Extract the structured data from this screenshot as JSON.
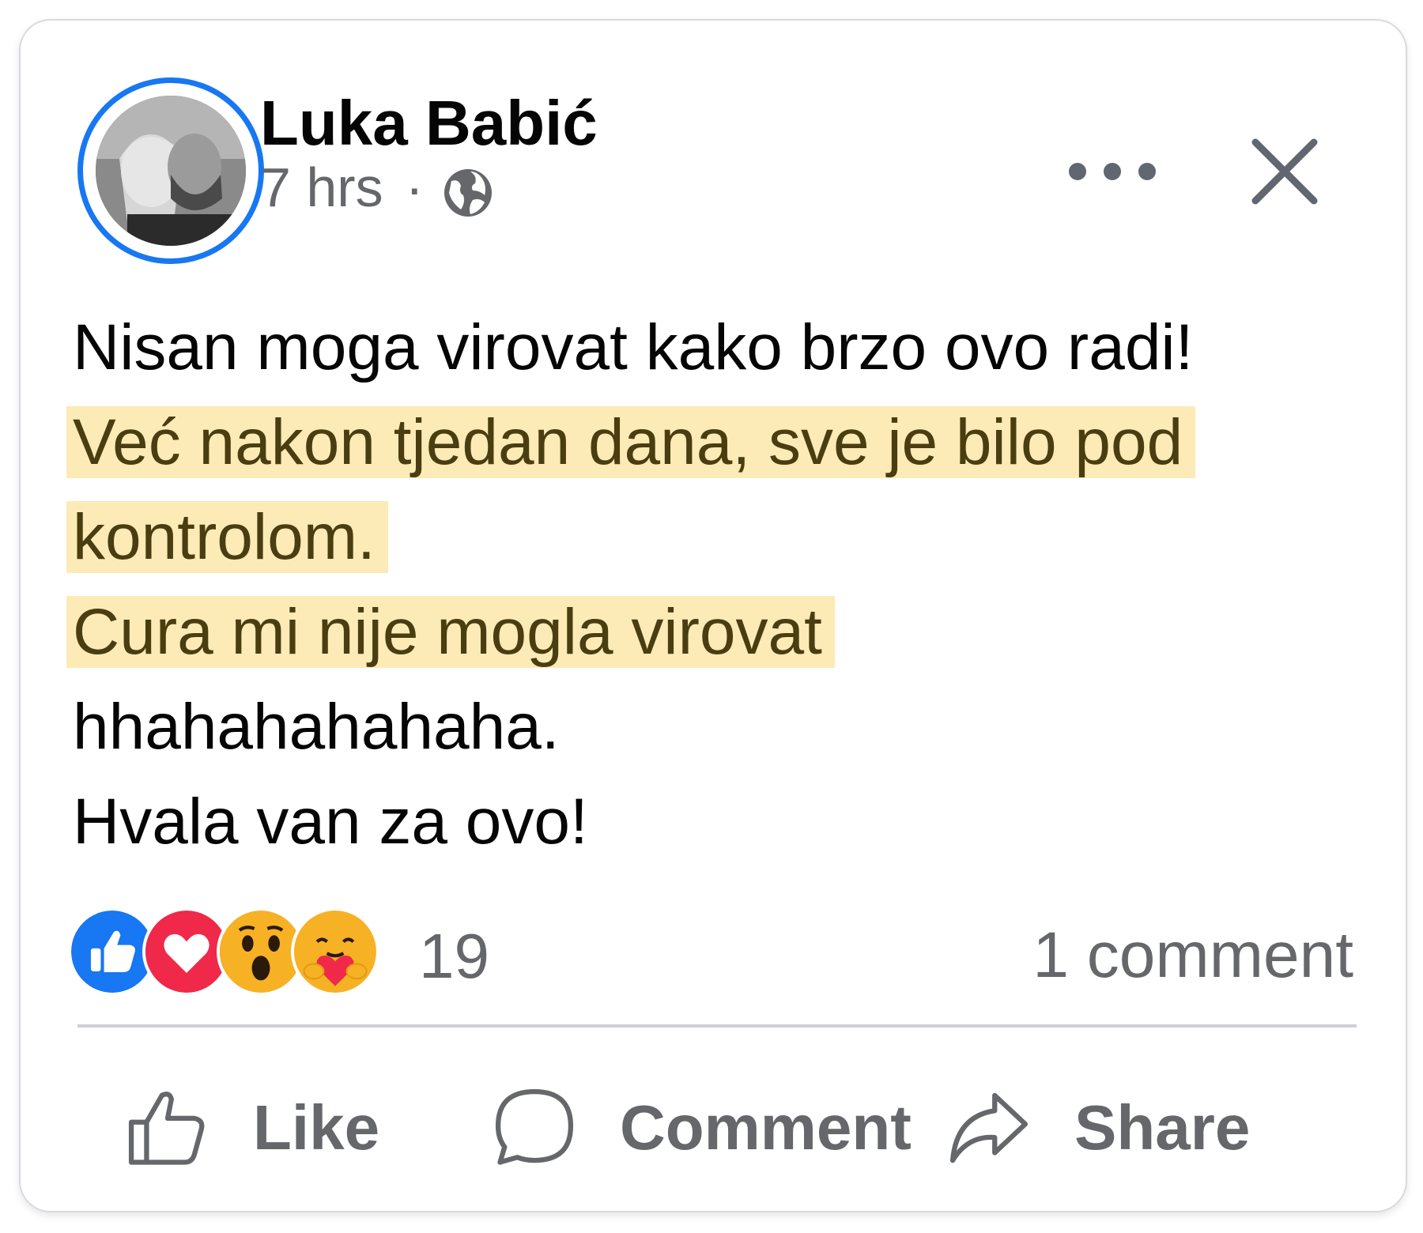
{
  "post": {
    "author": "Luka Babić",
    "time": "7 hrs",
    "separator": "·",
    "privacy_icon": "globe-icon",
    "lines": [
      {
        "text": "Nisan moga virovat kako brzo ovo radi!",
        "highlighted": false
      },
      {
        "text": "Već nakon tjedan dana, sve je bilo pod",
        "highlighted": true
      },
      {
        "text": "kontrolom.",
        "highlighted": true
      },
      {
        "text": "Cura mi nije mogla virovat",
        "highlighted": true
      },
      {
        "text": "hhahahahahaha.",
        "highlighted": false
      },
      {
        "text": "Hvala van za ovo!",
        "highlighted": false
      }
    ]
  },
  "reactions": {
    "icons": [
      "like-reaction-icon",
      "love-reaction-icon",
      "wow-reaction-icon",
      "care-reaction-icon"
    ],
    "count": "19",
    "comments": "1 comment"
  },
  "actions": {
    "like": "Like",
    "comment": "Comment",
    "share": "Share"
  },
  "colors": {
    "accent": "#1877f2",
    "highlight": "#fcebb6",
    "love": "#f0284a",
    "muted": "#65676b"
  }
}
